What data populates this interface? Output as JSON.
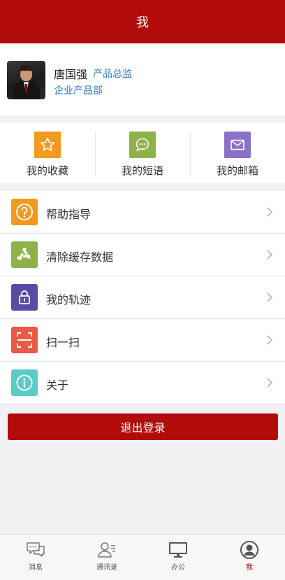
{
  "header": {
    "title": "我"
  },
  "profile": {
    "name": "唐国强",
    "title": "产品总监",
    "department": "企业产品部"
  },
  "quick_actions": [
    {
      "label": "我的收藏",
      "icon": "star-icon",
      "color": "#f39a1e"
    },
    {
      "label": "我的短语",
      "icon": "chat-bubble-icon",
      "color": "#8fb14a"
    },
    {
      "label": "我的邮箱",
      "icon": "mail-icon",
      "color": "#8b72c9"
    }
  ],
  "menu": [
    {
      "label": "帮助指导",
      "icon": "help-icon",
      "color": "#f39a1e"
    },
    {
      "label": "清除缓存数据",
      "icon": "recycle-icon",
      "color": "#8fb14a"
    },
    {
      "label": "我的轨迹",
      "icon": "lock-icon",
      "color": "#5a4ca6"
    },
    {
      "label": "扫一扫",
      "icon": "scan-icon",
      "color": "#ea5a44"
    },
    {
      "label": "关于",
      "icon": "info-icon",
      "color": "#5ccbc7"
    }
  ],
  "logout_label": "退出登录",
  "tabbar": [
    {
      "label": "消息",
      "icon": "message-icon",
      "active": false
    },
    {
      "label": "通讯录",
      "icon": "contacts-icon",
      "active": false
    },
    {
      "label": "办公",
      "icon": "monitor-icon",
      "active": false
    },
    {
      "label": "我",
      "icon": "user-icon",
      "active": true
    }
  ],
  "colors": {
    "brand": "#b20b0b",
    "link": "#2f7ec4",
    "background": "#f1f1f4"
  }
}
